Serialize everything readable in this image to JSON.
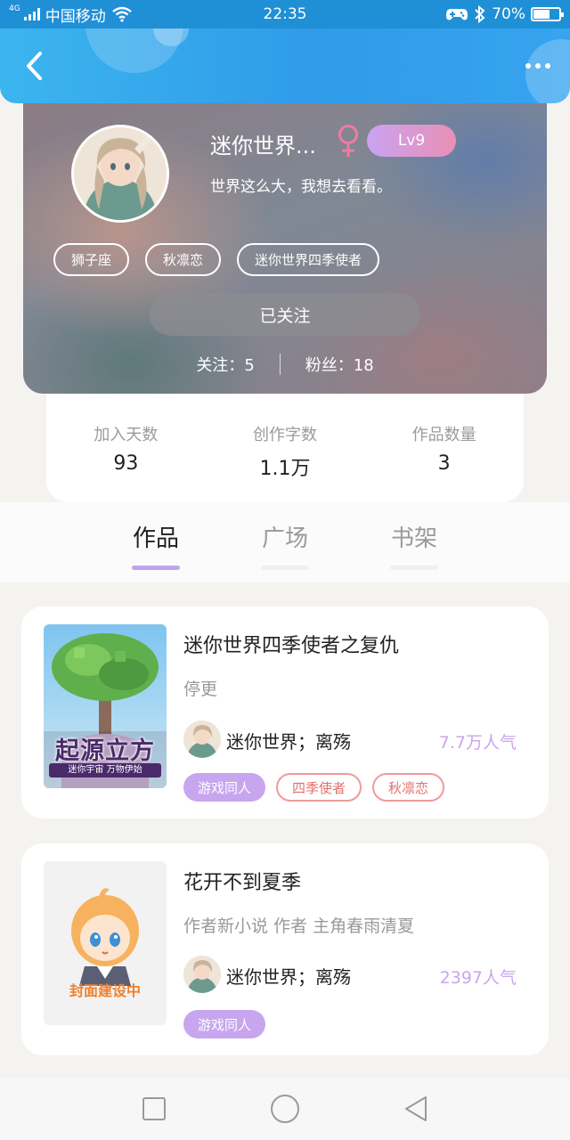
{
  "status_bar": {
    "carrier": "中国移动",
    "network_type": "4G",
    "time": "22:35",
    "battery_percent": "70%",
    "battery_level": 0.7
  },
  "header": {
    "back_icon": "chevron-left-icon",
    "more_icon": "more-dots-icon"
  },
  "profile": {
    "nickname": "迷你世界...",
    "gender_icon": "female-icon",
    "level": "Lv9",
    "signature": "世界这么大，我想去看看。",
    "tags": [
      "狮子座",
      "秋凛恋",
      "迷你世界四季使者"
    ],
    "follow_button": "已关注",
    "following_label": "关注：",
    "following_count": "5",
    "followers_label": "粉丝：",
    "followers_count": "18"
  },
  "stats": [
    {
      "label": "加入天数",
      "value": "93"
    },
    {
      "label": "创作字数",
      "value": "1.1万"
    },
    {
      "label": "作品数量",
      "value": "3"
    }
  ],
  "tabs": [
    "作品",
    "广场",
    "书架"
  ],
  "active_tab": "作品",
  "works": [
    {
      "title": "迷你世界四季使者之复仇",
      "status": "停更",
      "author": "迷你世界；离殇",
      "popularity": "7.7万人气",
      "tags": [
        "游戏同人",
        "四季使者",
        "秋凛恋"
      ],
      "cover_text": "起源立方",
      "cover_subtext": "迷你宇宙 万物伊始"
    },
    {
      "title": "花开不到夏季",
      "status": "作者新小说 作者 主角春雨清夏",
      "author": "迷你世界；离殇",
      "popularity": "2397人气",
      "tags": [
        "游戏同人"
      ],
      "cover_text": "封面建设中"
    }
  ],
  "colors": {
    "header_blue": "#2f9be9",
    "accent_purple": "#c7a6ef",
    "tag_red": "#e46f6f",
    "level_gradient_start": "#c9a3f2",
    "level_gradient_end": "#e98fb4"
  },
  "nav_bar": [
    "square-icon",
    "circle-icon",
    "back-triangle-icon"
  ]
}
